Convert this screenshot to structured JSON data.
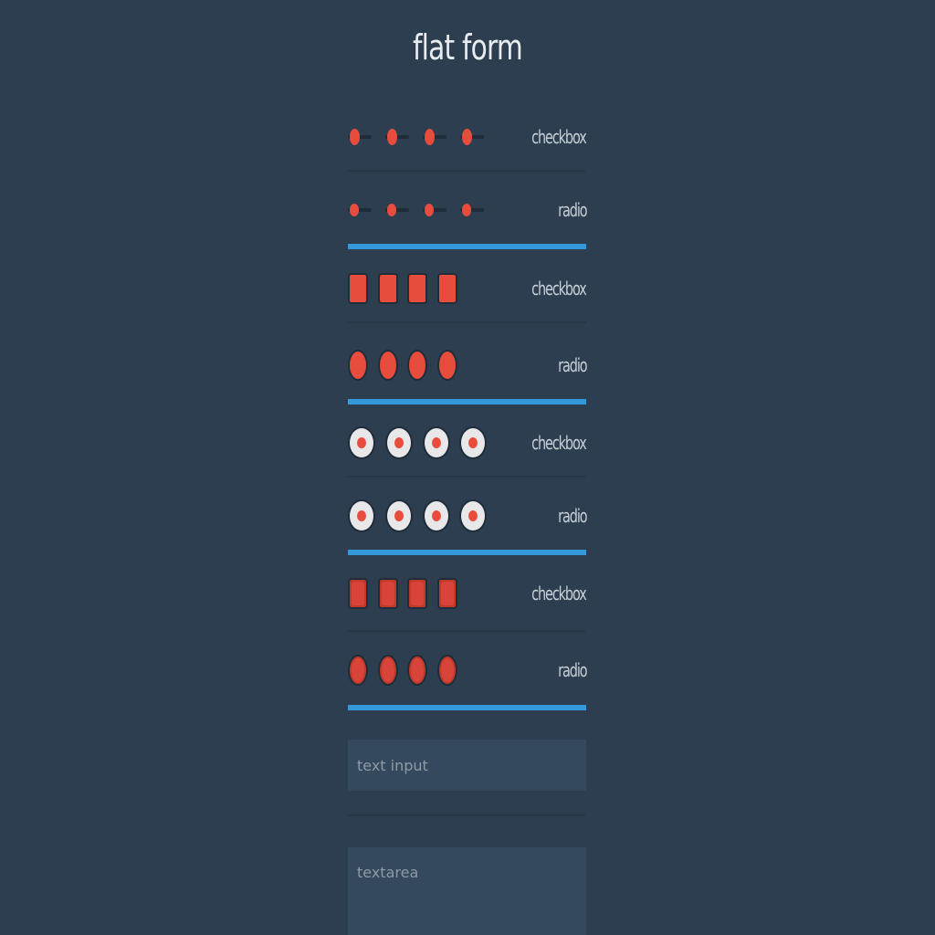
{
  "page": {
    "title": "flat form"
  },
  "colors": {
    "background": "#2c3e50",
    "accent_red": "#e74c3c",
    "accent_blue": "#3498db",
    "field_bg": "#34495e"
  },
  "groups": [
    {
      "style": "slider-toggle",
      "rows": [
        {
          "type": "checkbox",
          "label": "checkbox",
          "count": 4
        },
        {
          "type": "radio",
          "label": "radio",
          "count": 4
        }
      ]
    },
    {
      "style": "solid-red",
      "rows": [
        {
          "type": "checkbox",
          "label": "checkbox",
          "count": 4
        },
        {
          "type": "radio",
          "label": "radio",
          "count": 4
        }
      ]
    },
    {
      "style": "light-with-red-dot",
      "rows": [
        {
          "type": "checkbox",
          "label": "checkbox",
          "count": 4
        },
        {
          "type": "radio",
          "label": "radio",
          "count": 4
        }
      ]
    },
    {
      "style": "dark-red-bordered",
      "rows": [
        {
          "type": "checkbox",
          "label": "checkbox",
          "count": 4
        },
        {
          "type": "radio",
          "label": "radio",
          "count": 4
        }
      ]
    }
  ],
  "text_input": {
    "placeholder": "text input"
  },
  "textarea": {
    "placeholder": "textarea"
  }
}
